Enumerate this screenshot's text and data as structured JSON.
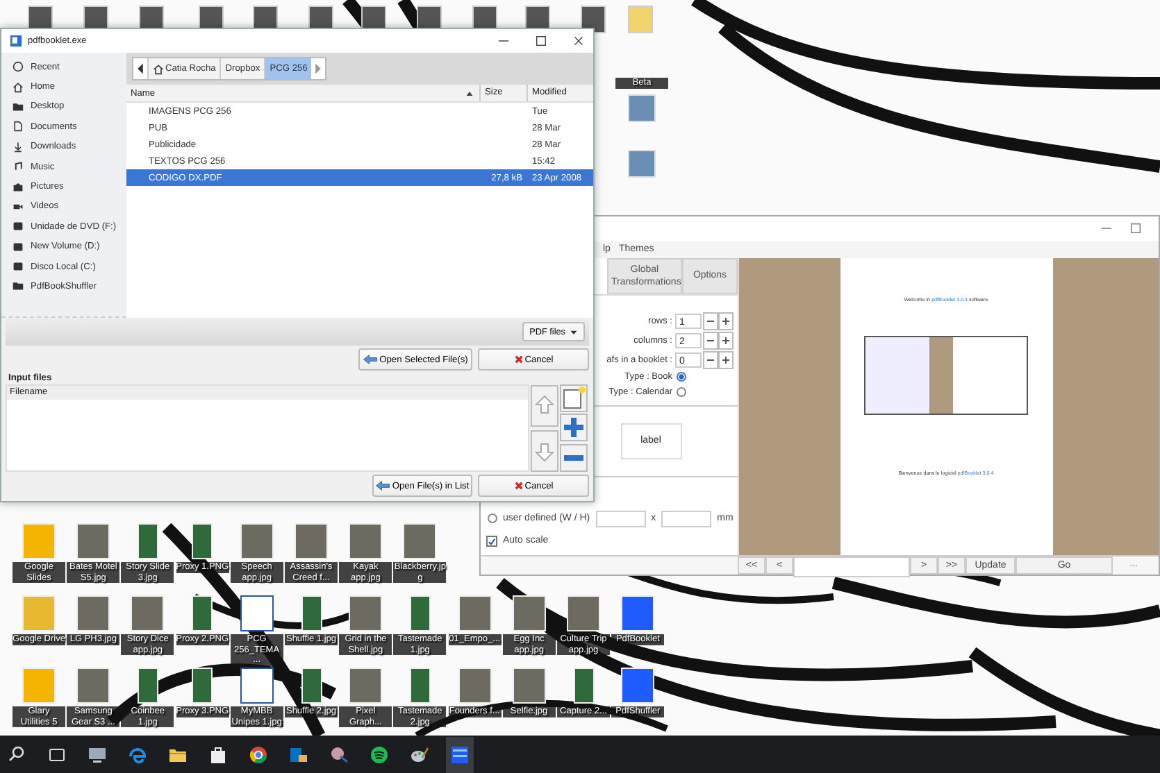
{
  "desktop": {
    "top_label": "Beta",
    "icon_rows": [
      [
        {
          "label": "Google Slides",
          "kind": "app"
        },
        {
          "label": "Bates Motel S5.jpg",
          "kind": "image"
        },
        {
          "label": "Story Slide 3.jpg",
          "kind": "phone"
        },
        {
          "label": "Proxy 1.PNG",
          "kind": "phone"
        },
        {
          "label": "Speech app.jpg",
          "kind": "image"
        },
        {
          "label": "Assassin's Creed f...",
          "kind": "image"
        },
        {
          "label": "Kayak app.jpg",
          "kind": "image"
        },
        {
          "label": "Blackberry.jpg",
          "kind": "image"
        }
      ],
      [
        {
          "label": "Google Drive",
          "kind": "folder"
        },
        {
          "label": "LG PH3.jpg",
          "kind": "image"
        },
        {
          "label": "Story Dice app.jpg",
          "kind": "image"
        },
        {
          "label": "Proxy 2.PNG",
          "kind": "phone"
        },
        {
          "label": "PCG 256_TEMA ...",
          "kind": "doc"
        },
        {
          "label": "Shuffle 1.jpg",
          "kind": "phone"
        },
        {
          "label": "Grid in the Shell.jpg",
          "kind": "image"
        },
        {
          "label": "Tastemade 1.jpg",
          "kind": "phone"
        },
        {
          "label": "01_Empo_...",
          "kind": "image"
        },
        {
          "label": "Egg Inc app.jpg",
          "kind": "image"
        },
        {
          "label": "Culture Trip app.jpg",
          "kind": "image"
        },
        {
          "label": "PdfBooklet",
          "kind": "pdf"
        }
      ],
      [
        {
          "label": "Glary Utilities 5",
          "kind": "app"
        },
        {
          "label": "Samsung Gear S3 ...",
          "kind": "image"
        },
        {
          "label": "Coinbee 1.jpg",
          "kind": "phone"
        },
        {
          "label": "Proxy 3.PNG",
          "kind": "phone"
        },
        {
          "label": "MyMBB Unipes 1.jpg",
          "kind": "doc"
        },
        {
          "label": "Shuffle 2.jpg",
          "kind": "phone"
        },
        {
          "label": "Pixel Graph...",
          "kind": "image"
        },
        {
          "label": "Tastemade 2.jpg",
          "kind": "phone"
        },
        {
          "label": "Founders f...",
          "kind": "image"
        },
        {
          "label": "Selfie.jpg",
          "kind": "image"
        },
        {
          "label": "Capture 2...",
          "kind": "phone"
        },
        {
          "label": "PdfShuffler",
          "kind": "pdf"
        }
      ]
    ]
  },
  "file_dialog": {
    "title": "pdfbooklet.exe",
    "places": [
      {
        "label": "Recent",
        "kind": "clock"
      },
      {
        "label": "Home",
        "kind": "home"
      },
      {
        "label": "Desktop",
        "kind": "folder"
      },
      {
        "label": "Documents",
        "kind": "doc"
      },
      {
        "label": "Downloads",
        "kind": "download"
      },
      {
        "label": "Music",
        "kind": "music"
      },
      {
        "label": "Pictures",
        "kind": "camera"
      },
      {
        "label": "Videos",
        "kind": "video"
      },
      {
        "label": "Unidade de DVD (F:)",
        "kind": "drive"
      },
      {
        "label": "New Volume (D:)",
        "kind": "drive"
      },
      {
        "label": "Disco Local (C:)",
        "kind": "drive"
      },
      {
        "label": "PdfBookShuffler",
        "kind": "folder"
      }
    ],
    "path": [
      {
        "label": "Catia Rocha",
        "kind": "home",
        "selected": false
      },
      {
        "label": "Dropbox",
        "kind": "folder",
        "selected": false
      },
      {
        "label": "PCG 256",
        "kind": "folder",
        "selected": true
      }
    ],
    "columns": [
      "Name",
      "Size",
      "Modified"
    ],
    "files": [
      {
        "name": "IMAGENS PCG 256",
        "modified": "Tue",
        "selected": false
      },
      {
        "name": "PUB",
        "modified": "28 Mar",
        "selected": false
      },
      {
        "name": "Publicidade",
        "modified": "28 Mar",
        "selected": false
      },
      {
        "name": "TEXTOS PCG 256",
        "modified": "15:42",
        "selected": false
      },
      {
        "name": "CODIGO DX.PDF",
        "size": "27,8 kB",
        "modified": "23 Apr 2008",
        "selected": true
      }
    ],
    "filter": "PDF files",
    "open_selected_button": "Open Selected File(s)",
    "cancel_button": "Cancel",
    "input_files_label": "Input files",
    "input_files_column": "Filename",
    "open_list_button": "Open File(s) in List",
    "cancel_button_2": "Cancel"
  },
  "main_window": {
    "menu": [
      "lp",
      "Themes"
    ],
    "tabs": [
      {
        "label": "Global Transformations",
        "selected": false
      },
      {
        "label": "Options",
        "selected": false
      }
    ],
    "spinners": [
      {
        "label": "rows :",
        "value": "1"
      },
      {
        "label": "columns :",
        "value": "2"
      },
      {
        "label": "afs in a booklet :",
        "value": "0"
      }
    ],
    "types": [
      {
        "label": "Type : Book",
        "selected": true
      },
      {
        "label": "Type : Calendar",
        "selected": false
      }
    ],
    "label_box": "label",
    "size_option": {
      "label": "user defined (W / H)",
      "selected": false,
      "separator": "x",
      "unit": "mm"
    },
    "auto_scale": {
      "label": "Auto scale",
      "checked": true
    },
    "preview": {
      "line_1": {
        "before": "Welcome in ",
        "link": "pdfBooklet 3.0.4",
        "after": " software"
      },
      "line_2": {
        "before": "Bienvenue dans le logiciel ",
        "link": "pdfBooklet 3.0.4"
      }
    },
    "nav": [
      {
        "label": "<<",
        "kind": "button"
      },
      {
        "label": "<",
        "kind": "button"
      },
      {
        "kind": "field"
      },
      {
        "label": ">",
        "kind": "button"
      },
      {
        "label": ">>",
        "kind": "button"
      },
      {
        "label": "Update",
        "kind": "button"
      },
      {
        "label": "Go",
        "kind": "wide"
      },
      {
        "label": "...",
        "kind": "plain"
      }
    ]
  }
}
